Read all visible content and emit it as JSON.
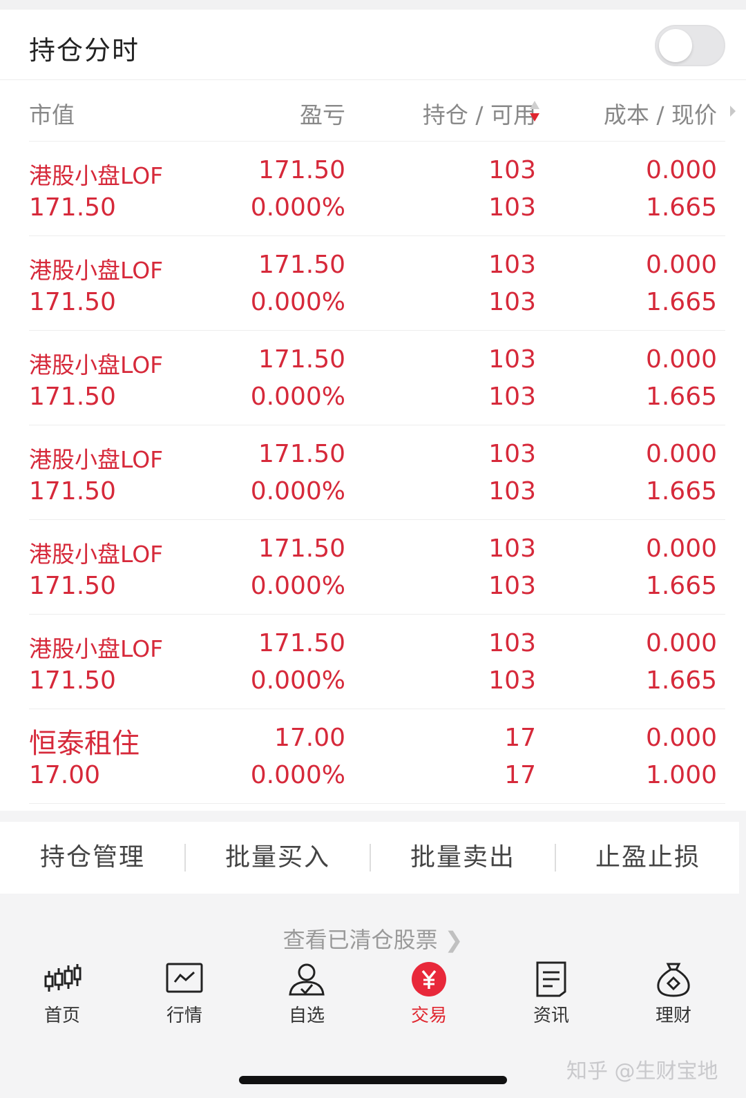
{
  "header": {
    "title": "持仓分时",
    "toggle_on": false
  },
  "columns": {
    "market_value": "市值",
    "profit_loss": "盈亏",
    "position_available": "持仓 / 可用",
    "cost_price": "成本 / 现价"
  },
  "rows": [
    {
      "name": "港股小盘LOF",
      "market_value": "171.50",
      "profit_loss": "171.50",
      "profit_loss_pct": "0.000%",
      "position": "103",
      "available": "103",
      "cost": "0.000",
      "price": "1.665"
    },
    {
      "name": "港股小盘LOF",
      "market_value": "171.50",
      "profit_loss": "171.50",
      "profit_loss_pct": "0.000%",
      "position": "103",
      "available": "103",
      "cost": "0.000",
      "price": "1.665"
    },
    {
      "name": "港股小盘LOF",
      "market_value": "171.50",
      "profit_loss": "171.50",
      "profit_loss_pct": "0.000%",
      "position": "103",
      "available": "103",
      "cost": "0.000",
      "price": "1.665"
    },
    {
      "name": "港股小盘LOF",
      "market_value": "171.50",
      "profit_loss": "171.50",
      "profit_loss_pct": "0.000%",
      "position": "103",
      "available": "103",
      "cost": "0.000",
      "price": "1.665"
    },
    {
      "name": "港股小盘LOF",
      "market_value": "171.50",
      "profit_loss": "171.50",
      "profit_loss_pct": "0.000%",
      "position": "103",
      "available": "103",
      "cost": "0.000",
      "price": "1.665"
    },
    {
      "name": "港股小盘LOF",
      "market_value": "171.50",
      "profit_loss": "171.50",
      "profit_loss_pct": "0.000%",
      "position": "103",
      "available": "103",
      "cost": "0.000",
      "price": "1.665"
    },
    {
      "name": "恒泰租住",
      "market_value": "17.00",
      "profit_loss": "17.00",
      "profit_loss_pct": "0.000%",
      "position": "17",
      "available": "17",
      "cost": "0.000",
      "price": "1.000"
    }
  ],
  "actions": [
    "持仓管理",
    "批量买入",
    "批量卖出",
    "止盈止损"
  ],
  "cleared_link": "查看已清仓股票",
  "tabbar": [
    {
      "label": "首页",
      "icon": "candlestick-icon",
      "active": false
    },
    {
      "label": "行情",
      "icon": "line-chart-icon",
      "active": false
    },
    {
      "label": "自选",
      "icon": "user-check-icon",
      "active": false
    },
    {
      "label": "交易",
      "icon": "yuan-coin-icon",
      "active": true
    },
    {
      "label": "资讯",
      "icon": "document-icon",
      "active": false
    },
    {
      "label": "理财",
      "icon": "money-bag-icon",
      "active": false
    }
  ],
  "watermark": "知乎 @生财宝地",
  "colors": {
    "accent_red": "#d6293a",
    "tab_active": "#e0262f",
    "muted_text": "#888888",
    "background": "#f4f4f5"
  }
}
